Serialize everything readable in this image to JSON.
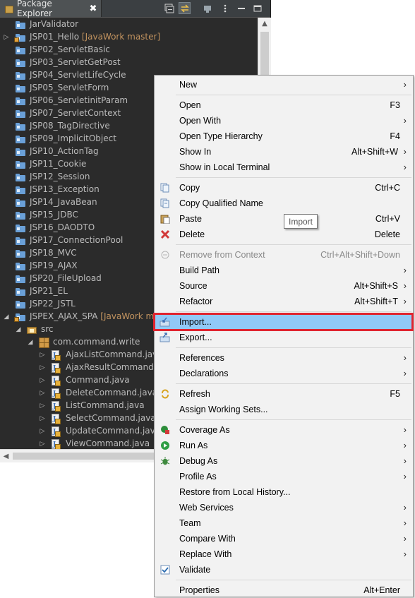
{
  "view": {
    "title": "Package Explorer",
    "close_glyph": "✖"
  },
  "tree": [
    {
      "label": "JarValidator",
      "kind": "project",
      "indent": 0,
      "twisty": ""
    },
    {
      "label": "JSP01_Hello",
      "dec": " [JavaWork master]",
      "kind": "project-git",
      "indent": 0,
      "twisty": "▷"
    },
    {
      "label": "JSP02_ServletBasic",
      "kind": "project",
      "indent": 0,
      "twisty": ""
    },
    {
      "label": "JSP03_ServletGetPost",
      "kind": "project",
      "indent": 0,
      "twisty": ""
    },
    {
      "label": "JSP04_ServletLifeCycle",
      "kind": "project",
      "indent": 0,
      "twisty": ""
    },
    {
      "label": "JSP05_ServletForm",
      "kind": "project",
      "indent": 0,
      "twisty": ""
    },
    {
      "label": "JSP06_ServletinitParam",
      "kind": "project",
      "indent": 0,
      "twisty": ""
    },
    {
      "label": "JSP07_ServletContext",
      "kind": "project",
      "indent": 0,
      "twisty": ""
    },
    {
      "label": "JSP08_TagDirective",
      "kind": "project",
      "indent": 0,
      "twisty": ""
    },
    {
      "label": "JSP09_ImplicitObject",
      "kind": "project",
      "indent": 0,
      "twisty": ""
    },
    {
      "label": "JSP10_ActionTag",
      "kind": "project",
      "indent": 0,
      "twisty": ""
    },
    {
      "label": "JSP11_Cookie",
      "kind": "project",
      "indent": 0,
      "twisty": ""
    },
    {
      "label": "JSP12_Session",
      "kind": "project",
      "indent": 0,
      "twisty": ""
    },
    {
      "label": "JSP13_Exception",
      "kind": "project",
      "indent": 0,
      "twisty": ""
    },
    {
      "label": "JSP14_JavaBean",
      "kind": "project",
      "indent": 0,
      "twisty": ""
    },
    {
      "label": "JSP15_JDBC",
      "kind": "project",
      "indent": 0,
      "twisty": ""
    },
    {
      "label": "JSP16_DAODTO",
      "kind": "project",
      "indent": 0,
      "twisty": ""
    },
    {
      "label": "JSP17_ConnectionPool",
      "kind": "project",
      "indent": 0,
      "twisty": ""
    },
    {
      "label": "JSP18_MVC",
      "kind": "project",
      "indent": 0,
      "twisty": ""
    },
    {
      "label": "JSP19_AJAX",
      "kind": "project",
      "indent": 0,
      "twisty": ""
    },
    {
      "label": "JSP20_FileUpload",
      "kind": "project",
      "indent": 0,
      "twisty": ""
    },
    {
      "label": "JSP21_EL",
      "kind": "project",
      "indent": 0,
      "twisty": ""
    },
    {
      "label": "JSP22_JSTL",
      "kind": "project",
      "indent": 0,
      "twisty": ""
    },
    {
      "label": "JSPEX_AJAX_SPA",
      "dec": " [JavaWork master]",
      "kind": "project-git",
      "indent": 0,
      "twisty": "◢"
    },
    {
      "label": "src",
      "kind": "src",
      "indent": 1,
      "twisty": "◢"
    },
    {
      "label": "com.command.write",
      "kind": "package",
      "indent": 2,
      "twisty": "◢"
    },
    {
      "label": "AjaxListCommand.java",
      "kind": "java",
      "indent": 3,
      "twisty": "▷"
    },
    {
      "label": "AjaxResultCommand.java",
      "kind": "java",
      "indent": 3,
      "twisty": "▷"
    },
    {
      "label": "Command.java",
      "kind": "java-i",
      "indent": 3,
      "twisty": "▷"
    },
    {
      "label": "DeleteCommand.java",
      "kind": "java",
      "indent": 3,
      "twisty": "▷"
    },
    {
      "label": "ListCommand.java",
      "kind": "java",
      "indent": 3,
      "twisty": "▷"
    },
    {
      "label": "SelectCommand.java",
      "kind": "java",
      "indent": 3,
      "twisty": "▷"
    },
    {
      "label": "UpdateCommand.java",
      "kind": "java",
      "indent": 3,
      "twisty": "▷"
    },
    {
      "label": "ViewCommand.java",
      "kind": "java",
      "indent": 3,
      "twisty": "▷"
    }
  ],
  "menu": [
    {
      "label": "New",
      "submenu": true
    },
    {
      "sep": true
    },
    {
      "label": "Open",
      "accel": "F3"
    },
    {
      "label": "Open With",
      "submenu": true
    },
    {
      "label": "Open Type Hierarchy",
      "accel": "F4"
    },
    {
      "label": "Show In",
      "accel": "Alt+Shift+W",
      "submenu": true
    },
    {
      "label": "Show in Local Terminal",
      "submenu": true
    },
    {
      "sep": true
    },
    {
      "label": "Copy",
      "accel": "Ctrl+C",
      "icon": "copy-icon"
    },
    {
      "label": "Copy Qualified Name",
      "icon": "copy-qualified-icon"
    },
    {
      "label": "Paste",
      "accel": "Ctrl+V",
      "icon": "paste-icon"
    },
    {
      "label": "Delete",
      "accel": "Delete",
      "icon": "delete-icon"
    },
    {
      "sep": true
    },
    {
      "label": "Remove from Context",
      "accel": "Ctrl+Alt+Shift+Down",
      "icon": "remove-context-icon",
      "disabled": true
    },
    {
      "label": "Build Path",
      "submenu": true
    },
    {
      "label": "Source",
      "accel": "Alt+Shift+S",
      "submenu": true
    },
    {
      "label": "Refactor",
      "accel": "Alt+Shift+T",
      "submenu": true
    },
    {
      "sep": true
    },
    {
      "label": "Import...",
      "icon": "import-icon",
      "highlighted": true
    },
    {
      "label": "Export...",
      "icon": "export-icon"
    },
    {
      "sep": true
    },
    {
      "label": "References",
      "submenu": true
    },
    {
      "label": "Declarations",
      "submenu": true
    },
    {
      "sep": true
    },
    {
      "label": "Refresh",
      "accel": "F5",
      "icon": "refresh-icon"
    },
    {
      "label": "Assign Working Sets..."
    },
    {
      "sep": true
    },
    {
      "label": "Coverage As",
      "submenu": true,
      "icon": "coverage-icon"
    },
    {
      "label": "Run As",
      "submenu": true,
      "icon": "run-icon"
    },
    {
      "label": "Debug As",
      "submenu": true,
      "icon": "debug-icon"
    },
    {
      "label": "Profile As",
      "submenu": true
    },
    {
      "label": "Restore from Local History..."
    },
    {
      "label": "Web Services",
      "submenu": true
    },
    {
      "label": "Team",
      "submenu": true
    },
    {
      "label": "Compare With",
      "submenu": true
    },
    {
      "label": "Replace With",
      "submenu": true
    },
    {
      "label": "Validate",
      "icon": "checkbox-checked-icon"
    },
    {
      "sep": true
    },
    {
      "label": "Properties",
      "accel": "Alt+Enter"
    }
  ],
  "tooltip": {
    "text": "Import"
  },
  "colors": {
    "highlight": "#91c9f7",
    "highlight_border": "#e0242f",
    "git_decoration": "#c2935f"
  }
}
